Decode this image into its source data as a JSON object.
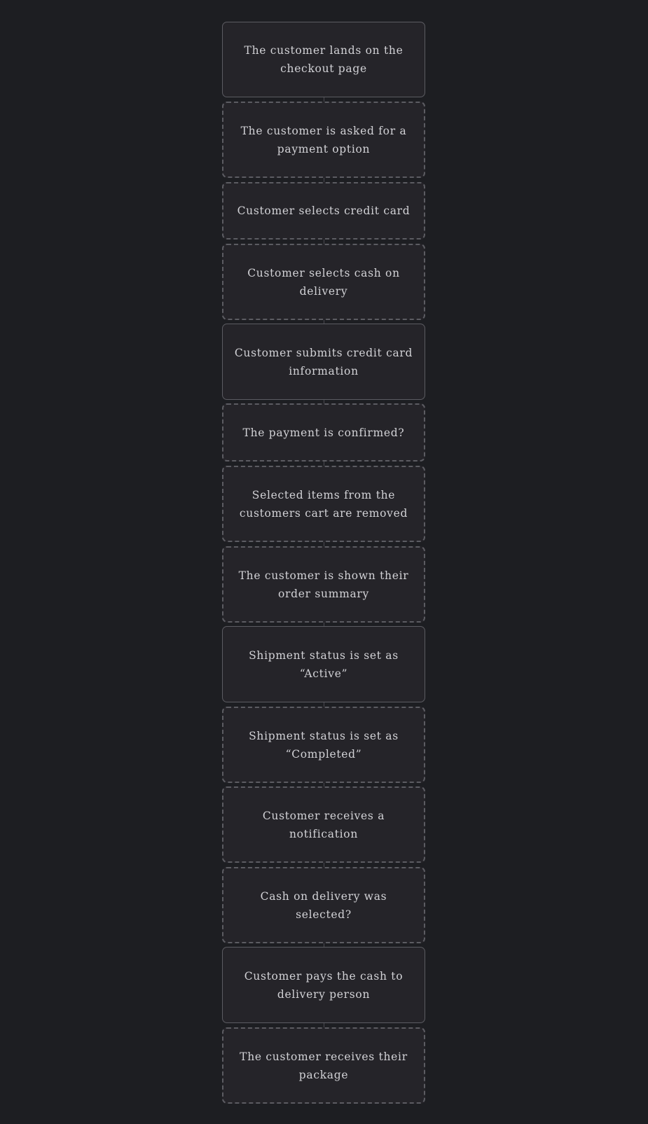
{
  "flow": {
    "steps": [
      {
        "label": "The customer lands on the checkout page",
        "border": "solid"
      },
      {
        "label": "The customer is asked for a payment option",
        "border": "dashed"
      },
      {
        "label": "Customer selects credit card",
        "border": "dashed"
      },
      {
        "label": "Customer selects cash on delivery",
        "border": "dashed"
      },
      {
        "label": "Customer submits credit card information",
        "border": "solid"
      },
      {
        "label": "The payment is confirmed?",
        "border": "dashed"
      },
      {
        "label": "Selected items from the customers cart are removed",
        "border": "dashed"
      },
      {
        "label": "The customer is shown their order summary",
        "border": "dashed"
      },
      {
        "label": "Shipment status is set as “Active”",
        "border": "solid"
      },
      {
        "label": "Shipment status is set as “Completed”",
        "border": "dashed"
      },
      {
        "label": "Customer receives a notification",
        "border": "dashed"
      },
      {
        "label": "Cash on delivery was selected?",
        "border": "dashed"
      },
      {
        "label": "Customer pays the cash to delivery person",
        "border": "solid"
      },
      {
        "label": "The customer receives their package",
        "border": "dashed"
      }
    ]
  },
  "colors": {
    "background": "#1d1e22",
    "card": "#252429",
    "border": "#5c5c62",
    "text": "#d2d2d6"
  }
}
